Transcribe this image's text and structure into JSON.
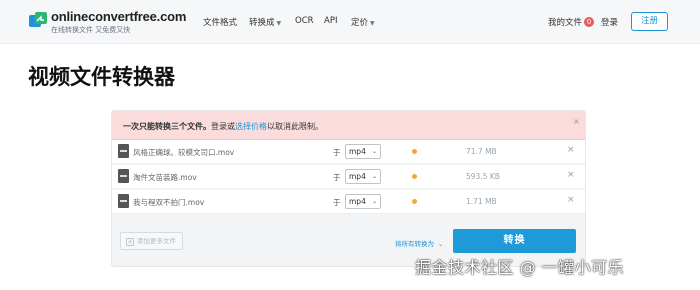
{
  "header": {
    "logo_text": "onlineconvertfree.com",
    "logo_subtitle": "在线转换文件 又免费又快",
    "nav": [
      {
        "label": "文件格式",
        "dropdown": false
      },
      {
        "label": "转换成",
        "dropdown": true
      },
      {
        "label": "OCR",
        "dropdown": false
      },
      {
        "label": "API",
        "dropdown": false
      },
      {
        "label": "定价",
        "dropdown": true
      }
    ],
    "my_files_label": "我的文件",
    "my_files_count": "0",
    "login_label": "登录",
    "register_label": "注册"
  },
  "page_title": "视频文件转换器",
  "alert": {
    "text_bold": "一次只能转换三个文件。",
    "text_pre": "登录或",
    "link": "选择价格",
    "text_post": "以取消此限制。",
    "close": "×"
  },
  "files": [
    {
      "name": "风格正确球。较模文司口.mov",
      "to_label": "于",
      "format": "mp4",
      "size": "71.7 MB",
      "close": "×"
    },
    {
      "name": "淘件文苗装路.mov",
      "to_label": "于",
      "format": "mp4",
      "size": "593.5 KB",
      "close": "×"
    },
    {
      "name": "我与程双不拍门.mov",
      "to_label": "于",
      "format": "mp4",
      "size": "1.71 MB",
      "close": "×"
    }
  ],
  "actions": {
    "add_files": "添加更多文件",
    "convert_all": "将所有转换为",
    "convert": "转换"
  },
  "watermark": "掘金技术社区 @ 一罐小可乐",
  "colors": {
    "accent": "#1f9ad8",
    "alert_bg": "#fadcdc",
    "badge": "#e25d5d",
    "status_dot": "#f0a938"
  }
}
